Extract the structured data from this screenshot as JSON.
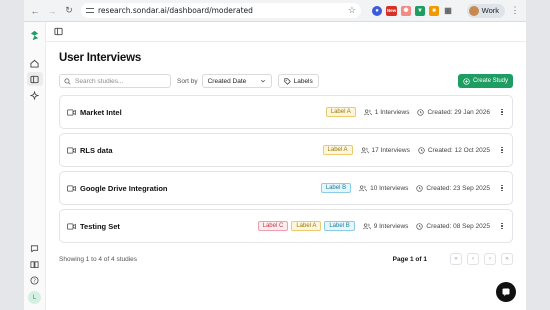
{
  "browser": {
    "url": "research.sondar.ai/dashboard/moderated",
    "profile_name": "Work",
    "extensions": [
      "extension-icon",
      "new-badge-extension-icon",
      "extension-icon",
      "extension-icon",
      "extension-icon",
      "puzzle-icon"
    ],
    "new_badge": "New"
  },
  "rail": {
    "avatar_initial": "L"
  },
  "page": {
    "title": "User Interviews",
    "search_placeholder": "Search studies...",
    "sort_label": "Sort by",
    "sort_value": "Created Date",
    "labels_button": "Labels",
    "create_button": "Create Study"
  },
  "studies": [
    {
      "title": "Market Intel",
      "labels": [
        "Label A"
      ],
      "interviews": "1 Interviews",
      "created": "Created: 29 Jan 2026"
    },
    {
      "title": "RLS data",
      "labels": [
        "Label A"
      ],
      "interviews": "17 Interviews",
      "created": "Created: 12 Oct 2025"
    },
    {
      "title": "Google Drive Integration",
      "labels": [
        "Label B"
      ],
      "interviews": "10 Interviews",
      "created": "Created: 23 Sep 2025"
    },
    {
      "title": "Testing Set",
      "labels": [
        "Label C",
        "Label A",
        "Label B"
      ],
      "interviews": "9 Interviews",
      "created": "Created: 08 Sep 2025"
    }
  ],
  "pagination": {
    "showing": "Showing 1 to 4 of 4 studies",
    "page_info": "Page 1 of 1"
  },
  "colors": {
    "accent_green": "#1e9d63",
    "label_a": "#ebcb6b",
    "label_b": "#8bcde3",
    "label_c": "#eba0ab"
  }
}
